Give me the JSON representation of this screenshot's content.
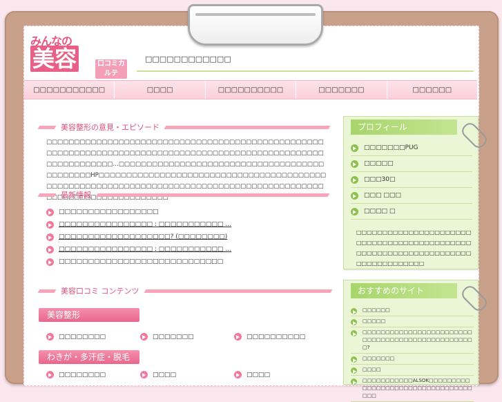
{
  "site": {
    "logo_small": "みんなの",
    "logo_main": "美容",
    "logo_sub": "口コミカルテ",
    "tagline": "□□□□□□□□□□□□"
  },
  "nav": [
    "□□□□□□□□□□□",
    "□□□□",
    "□□□□□□□□□□",
    "□□□□□□□",
    "□□□□□□"
  ],
  "main": {
    "opinion_heading": "美容整形の意見・エピソード",
    "intro_text": "□□□□□□□□□□□□□□□□□□□□□□□□□□□□□□□□□□□□□□□□□□□□□□□□□□□□□□□□□□□□□□□□□□□□□□□□□□□□□□□□□□□□□□□□□□□□□□□□□□□□□□□□□□□□□□□□…□□□□□□□□□□□□□□□□□□□□□□□□□□□□□□□□□□□□□□□□□□□□□HP□□□□□□□□□□□□□□□□□□□□□□□□□□□□□□□□□□□□□□□□□□□□□□□□□□□□□□□□□□□□□□□□□□□□□□□□□□□□□□□□□□□□□□□□□□□□□□□□□□□□□□□□□□□□□□□□□",
    "news_heading": "最新情報",
    "news": [
      {
        "text": "□□□□□□□□□□□□□□□□□",
        "link": false
      },
      {
        "text": "□□□□□□□□□□□□□□□□ : □□□□□□□□□□□ …",
        "link": true
      },
      {
        "text": "□□□□□□□□□□□□□□□□□□□? (□□□□□□□□)",
        "link": true
      },
      {
        "text": "□□□□□□□□□□□□□□□□ : □□□□□□□□□□□ …",
        "link": true
      },
      {
        "text": "□□□□□□□□□□□□□□□□□□□□□□□□□□□□",
        "link": false
      }
    ],
    "contents_heading": "美容口コミ コンテンツ",
    "categories": [
      {
        "label": "美容整形",
        "items": [
          "□□□□□□□□",
          "□□□□□□□",
          "□□□□□□□□□□"
        ]
      },
      {
        "label": "わきが・多汗症・脱毛",
        "items": [
          "□□□□□□□□",
          "□□□□",
          "□□□□"
        ]
      }
    ]
  },
  "sidebar": {
    "profile_title": "プロフィール",
    "profile_items": [
      "□□□□□□□PUG",
      "□□□□□",
      "□□□30□",
      "□□□ □□□",
      "□□□□ □"
    ],
    "profile_desc": "□□□□□□□□□□□□□□□□□□□□□□□□□□□□□□□□□□□□□□□□□□□□□□□□□□□□□□□□□□□□□□□□□□□□□□□□□□□□□□□",
    "links_title": "おすすめのサイト",
    "links": [
      "□□□□□□",
      "□□□□□",
      "□□□□□□□□□□□□□□□□□□□□□□□□□□□□□□□□□□□□□□□□□□□□□□□□□?",
      "□□□□□□□",
      "□□□□",
      "□□□□□□□□□□□ALSOK□□□□□□□□□□□□□□□□□□□□□□□□□□□□□□□□□□□□"
    ]
  }
}
